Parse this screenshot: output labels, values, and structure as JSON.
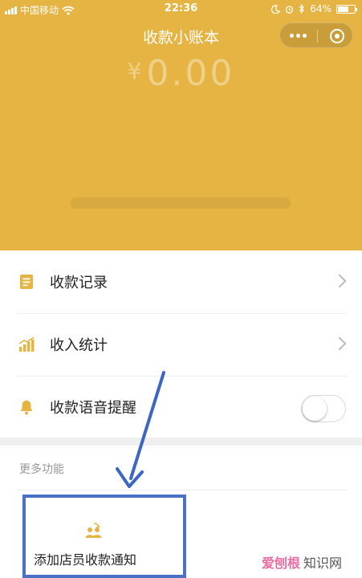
{
  "status_bar": {
    "carrier": "中国移动",
    "time": "22:36",
    "battery": "64%",
    "battery_level": 0.64
  },
  "nav": {
    "title": "收款小账本"
  },
  "summary": {
    "currency": "¥",
    "amount": "0.00"
  },
  "menu": {
    "items": [
      {
        "label": "收款记录",
        "icon": "document-icon",
        "accessory": "chevron"
      },
      {
        "label": "收入统计",
        "icon": "bar-chart-icon",
        "accessory": "chevron"
      },
      {
        "label": "收款语音提醒",
        "icon": "bell-icon",
        "accessory": "toggle",
        "toggle_on": false
      }
    ]
  },
  "more": {
    "title": "更多功能",
    "features": [
      {
        "label": "添加店员收款通知",
        "icon": "staff-group-icon"
      }
    ]
  },
  "watermark": {
    "brand_a": "爱刨根",
    "brand_b": "知识网"
  },
  "colors": {
    "header": "#e5b442",
    "accent_icon": "#e5b442",
    "highlight_box": "#4a71c6",
    "arrow": "#3d66c4"
  }
}
